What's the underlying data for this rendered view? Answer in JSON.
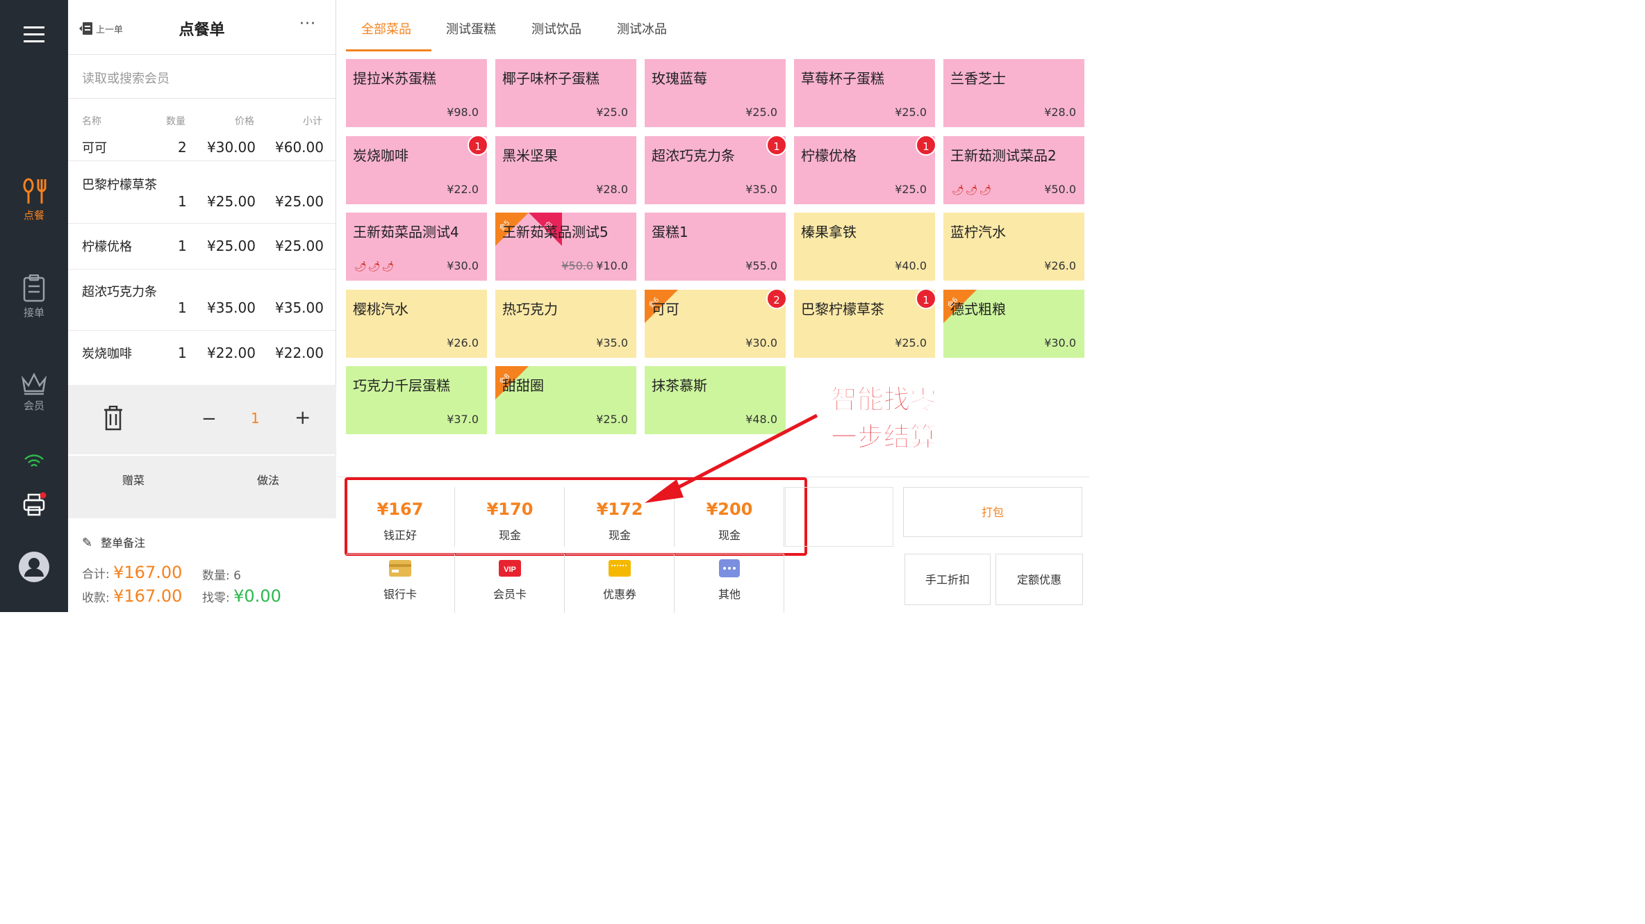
{
  "sidebar": {
    "items": [
      {
        "label": "点餐",
        "icon": "utensils-icon"
      },
      {
        "label": "接单",
        "icon": "clipboard-icon"
      },
      {
        "label": "会员",
        "icon": "crown-icon"
      }
    ],
    "wifi_icon": "wifi-icon",
    "printer_icon": "printer-icon",
    "avatar_icon": "user-avatar-icon"
  },
  "order": {
    "prev_label": "上一单",
    "title": "点餐单",
    "more_label": "···",
    "search_placeholder": "读取或搜索会员",
    "columns": {
      "name": "名称",
      "qty": "数量",
      "price": "价格",
      "subtotal": "小计"
    },
    "rows": [
      {
        "name": "可可",
        "qty": "2",
        "price": "¥30.00",
        "subtotal": "¥60.00"
      },
      {
        "name": "巴黎柠檬草茶",
        "qty": "1",
        "price": "¥25.00",
        "subtotal": "¥25.00"
      },
      {
        "name": "柠檬优格",
        "qty": "1",
        "price": "¥25.00",
        "subtotal": "¥25.00"
      },
      {
        "name": "超浓巧克力条",
        "qty": "1",
        "price": "¥35.00",
        "subtotal": "¥35.00"
      },
      {
        "name": "炭烧咖啡",
        "qty": "1",
        "price": "¥22.00",
        "subtotal": "¥22.00"
      }
    ],
    "stepper": {
      "minus": "−",
      "value": "1",
      "plus": "+"
    },
    "actions": {
      "gift": "赠菜",
      "method": "做法"
    },
    "remark": "整单备注",
    "total_label": "合计:",
    "total_value": "¥167.00",
    "count_label": "数量:",
    "count_value": "6",
    "received_label": "收款:",
    "received_value": "¥167.00",
    "change_label": "找零:",
    "change_value": "¥0.00"
  },
  "menu": {
    "tabs": [
      "全部菜品",
      "测试蛋糕",
      "测试饮品",
      "测试冰品"
    ],
    "active_tab": 0,
    "dishes": [
      {
        "name": "提拉米苏蛋糕",
        "price": "¥98.0",
        "color": "pink"
      },
      {
        "name": "椰子味杯子蛋糕",
        "price": "¥25.0",
        "color": "pink"
      },
      {
        "name": "玫瑰蓝莓",
        "price": "¥25.0",
        "color": "pink"
      },
      {
        "name": "草莓杯子蛋糕",
        "price": "¥25.0",
        "color": "pink"
      },
      {
        "name": "兰香芝士",
        "price": "¥28.0",
        "color": "pink"
      },
      {
        "name": "炭烧咖啡",
        "price": "¥22.0",
        "color": "pink",
        "badge": "1"
      },
      {
        "name": "黑米坚果",
        "price": "¥28.0",
        "color": "pink"
      },
      {
        "name": "超浓巧克力条",
        "price": "¥35.0",
        "color": "pink",
        "badge": "1"
      },
      {
        "name": "柠檬优格",
        "price": "¥25.0",
        "color": "pink",
        "badge": "1"
      },
      {
        "name": "王新茹测试菜品2",
        "price": "¥50.0",
        "color": "pink",
        "chili": "🌶🌶🌶"
      },
      {
        "name": "王新茹菜品测试4",
        "price": "¥30.0",
        "color": "pink",
        "chili": "🌶🌶🌶"
      },
      {
        "name": "王新茹菜品测试5",
        "price": "¥10.0",
        "old_price": "¥50.0",
        "color": "pink",
        "ribbon": "会5",
        "ribbon2": "促"
      },
      {
        "name": "蛋糕1",
        "price": "¥55.0",
        "color": "pink"
      },
      {
        "name": "榛果拿铁",
        "price": "¥40.0",
        "color": "yellow"
      },
      {
        "name": "蓝柠汽水",
        "price": "¥26.0",
        "color": "yellow"
      },
      {
        "name": "樱桃汽水",
        "price": "¥26.0",
        "color": "yellow"
      },
      {
        "name": "热巧克力",
        "price": "¥35.0",
        "color": "yellow"
      },
      {
        "name": "可可",
        "price": "¥30.0",
        "color": "yellow",
        "badge": "2",
        "ribbon": "会6"
      },
      {
        "name": "巴黎柠檬草茶",
        "price": "¥25.0",
        "color": "yellow",
        "badge": "1"
      },
      {
        "name": "德式粗粮",
        "price": "¥30.0",
        "color": "green",
        "ribbon": "会6"
      },
      {
        "name": "巧克力千层蛋糕",
        "price": "¥37.0",
        "color": "green"
      },
      {
        "name": "甜甜圈",
        "price": "¥25.0",
        "color": "green",
        "ribbon": "会8"
      },
      {
        "name": "抹茶慕斯",
        "price": "¥48.0",
        "color": "green"
      }
    ]
  },
  "payment": {
    "quick": [
      {
        "amount": "¥167",
        "label": "钱正好"
      },
      {
        "amount": "¥170",
        "label": "现金"
      },
      {
        "amount": "¥172",
        "label": "现金"
      },
      {
        "amount": "¥200",
        "label": "现金"
      }
    ],
    "methods": [
      {
        "label": "银行卡",
        "icon": "bank-card-icon"
      },
      {
        "label": "会员卡",
        "icon": "vip-card-icon",
        "icon_text": "VIP"
      },
      {
        "label": "优惠券",
        "icon": "coupon-icon"
      },
      {
        "label": "其他",
        "icon": "more-icon",
        "icon_text": "···"
      }
    ],
    "pack": "打包",
    "manual_discount": "手工折扣",
    "fixed_discount": "定额优惠"
  },
  "promo": {
    "line1": "智能找零",
    "line2": "一步结算"
  },
  "colors": {
    "accent": "#f5821f",
    "pink": "#f9b3cf",
    "yellow": "#fbe9a8",
    "green": "#cdf59e",
    "sidebar": "#262c33",
    "highlight": "#e8161f"
  }
}
